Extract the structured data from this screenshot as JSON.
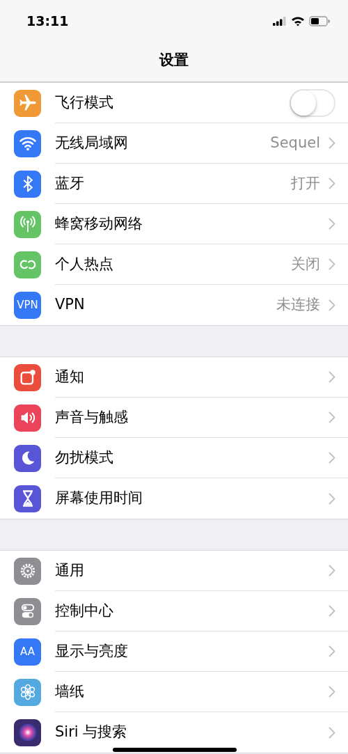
{
  "status_bar": {
    "time": "13:11"
  },
  "title": "设置",
  "groups": [
    {
      "items": [
        {
          "kind": "toggle",
          "color": "#f09a37",
          "label": "飞行模式",
          "on": false
        },
        {
          "kind": "link",
          "color": "#3478f6",
          "label": "无线局域网",
          "value": "Sequel"
        },
        {
          "kind": "link",
          "color": "#3478f6",
          "label": "蓝牙",
          "value": "打开"
        },
        {
          "kind": "link",
          "color": "#65c466",
          "label": "蜂窝移动网络"
        },
        {
          "kind": "link",
          "color": "#65c466",
          "label": "个人热点",
          "value": "关闭"
        },
        {
          "kind": "link",
          "icon_text": "VPN",
          "color": "#3478f6",
          "label": "VPN",
          "value": "未连接"
        }
      ]
    },
    {
      "items": [
        {
          "kind": "link",
          "color": "#eb4d3d",
          "label": "通知"
        },
        {
          "kind": "link",
          "color": "#eb445a",
          "label": "声音与触感"
        },
        {
          "kind": "link",
          "color": "#5856d6",
          "label": "勿扰模式"
        },
        {
          "kind": "link",
          "color": "#5856d6",
          "label": "屏幕使用时间"
        }
      ]
    },
    {
      "items": [
        {
          "kind": "link",
          "color": "#8e8e93",
          "label": "通用"
        },
        {
          "kind": "link",
          "color": "#8e8e93",
          "label": "控制中心"
        },
        {
          "kind": "link",
          "icon_text": "AA",
          "color": "#3478f6",
          "label": "显示与亮度"
        },
        {
          "kind": "link",
          "color": "#54a9e0",
          "label": "墙纸"
        },
        {
          "kind": "link",
          "color": "#3a2a6e",
          "label": "Siri 与搜索"
        }
      ]
    }
  ]
}
